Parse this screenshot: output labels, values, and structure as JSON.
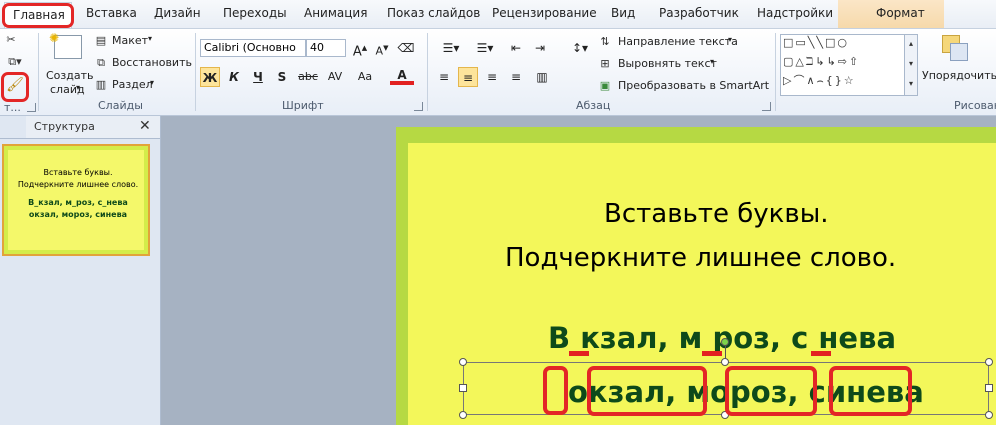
{
  "tabs": [
    "Главная",
    "Вставка",
    "Дизайн",
    "Переходы",
    "Анимация",
    "Показ слайдов",
    "Рецензирование",
    "Вид",
    "Разработчик",
    "Надстройки",
    "Формат"
  ],
  "ribbon": {
    "groups": {
      "slides": "Слайды",
      "font": "Шрифт",
      "paragraph": "Абзац",
      "drawing": "Рисован"
    },
    "clipboard_label": "т...",
    "create_slide": [
      "Создать",
      "слайд"
    ],
    "layout": "Макет",
    "restore": "Восстановить",
    "section": "Раздел",
    "font_name": "Calibri (Основно",
    "font_size": "40",
    "bold": "Ж",
    "italic": "К",
    "underline": "Ч",
    "shadow": "S",
    "strike": "abc",
    "spacing": "AV",
    "case": "Aa",
    "font_color": "A",
    "text_direction": "Направление текста",
    "align_text": "Выровнять текст",
    "smartart": "Преобразовать в SmartArt",
    "arrange": "Упорядочить"
  },
  "leftpane": {
    "tab": "Структура",
    "thumb": [
      "Вставьте буквы.",
      "Подчеркните лишнее слово.",
      "В_кзал, м_роз, с_нева",
      "окзал, мороз, синева"
    ]
  },
  "slide": {
    "line1": "Вставьте буквы.",
    "line2": "Подчеркните лишнее слово.",
    "line3": "В  кзал, м  роз, с  нева",
    "line4": "окзал, мороз, синева"
  },
  "colors": {
    "accent_red": "#e22121",
    "slide_bg": "#f3f75a",
    "slide_border": "#b6d943",
    "word_green": "#0e4a1a"
  }
}
